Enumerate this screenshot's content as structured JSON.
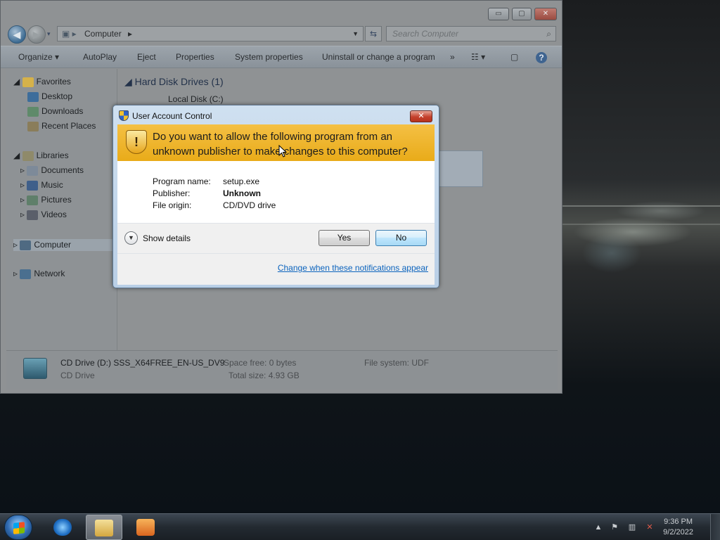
{
  "explorer": {
    "window_buttons": {
      "minimize": "▭",
      "maximize": "▢",
      "close": "✕"
    },
    "address_path": "Computer",
    "search_placeholder": "Search Computer",
    "toolbar": {
      "organize": "Organize ▾",
      "autoplay": "AutoPlay",
      "eject": "Eject",
      "properties": "Properties",
      "system_properties": "System properties",
      "uninstall": "Uninstall or change a program",
      "more": "»"
    },
    "nav": {
      "favorites": "Favorites",
      "desktop": "Desktop",
      "downloads": "Downloads",
      "recent_places": "Recent Places",
      "libraries": "Libraries",
      "documents": "Documents",
      "music": "Music",
      "pictures": "Pictures",
      "videos": "Videos",
      "computer": "Computer",
      "network": "Network"
    },
    "content": {
      "group_header": "Hard Disk Drives (1)",
      "local_disk": "Local Disk (C:)"
    },
    "details": {
      "title": "CD Drive (D:) SSS_X64FREE_EN-US_DV9",
      "subtitle": "CD Drive",
      "space_free": "Space free: 0 bytes",
      "total_size": "Total size: 4.93 GB",
      "file_system": "File system: UDF"
    }
  },
  "uac": {
    "title": "User Account Control",
    "question": "Do you want to allow the following program from an unknown publisher to make changes to this computer?",
    "program_name_label": "Program name:",
    "program_name": "setup.exe",
    "publisher_label": "Publisher:",
    "publisher": "Unknown",
    "file_origin_label": "File origin:",
    "file_origin": "CD/DVD drive",
    "show_details": "Show details",
    "yes": "Yes",
    "no": "No",
    "change_link": "Change when these notifications appear"
  },
  "taskbar": {
    "time": "9:36 PM",
    "date": "9/2/2022"
  },
  "colors": {
    "uac_banner": "#e9ab19",
    "link": "#0b63bd",
    "taskbar": "#232a31"
  }
}
